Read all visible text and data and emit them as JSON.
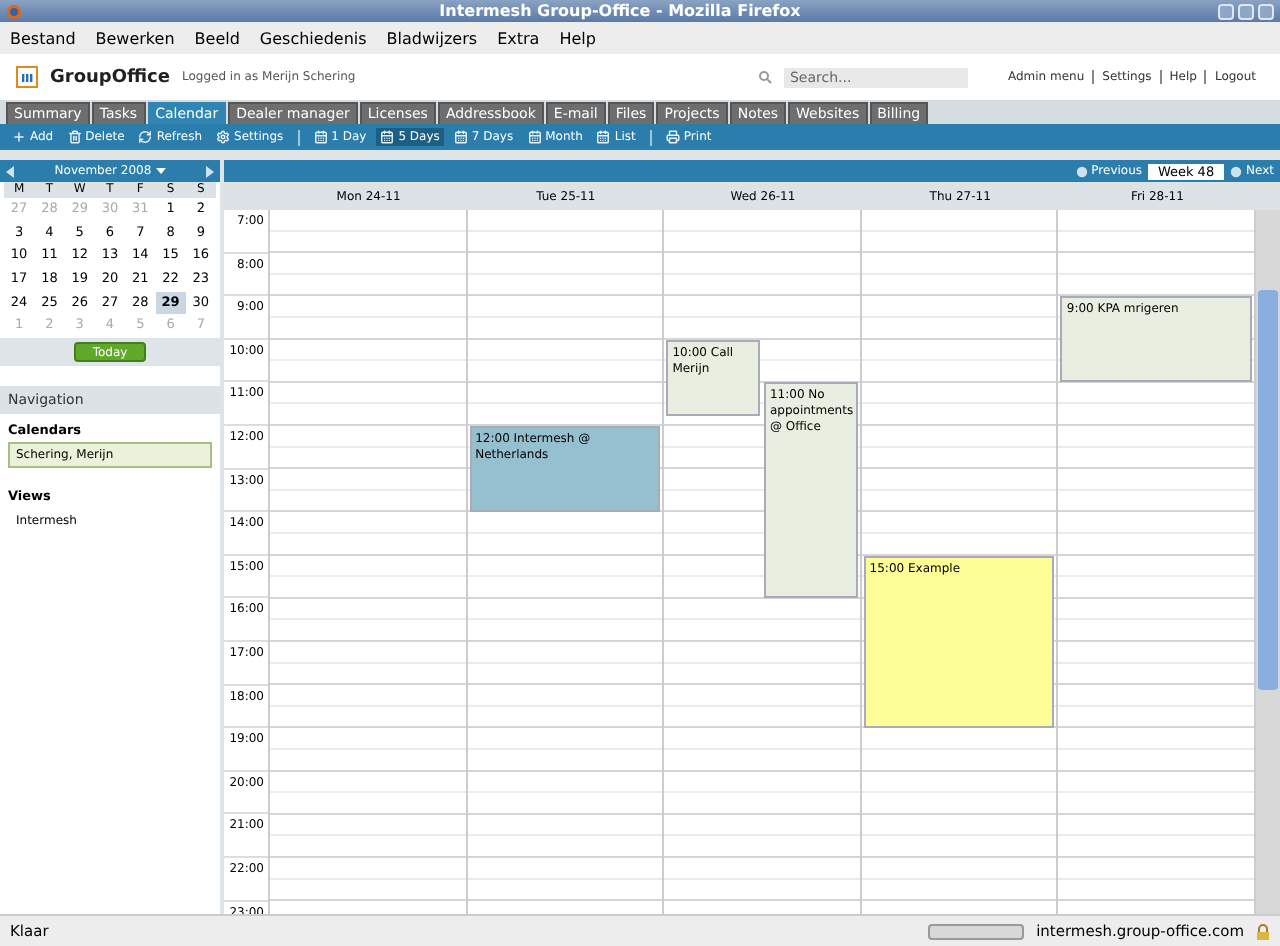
{
  "window": {
    "title": "Intermesh Group-Office - Mozilla Firefox"
  },
  "menu": [
    "Bestand",
    "Bewerken",
    "Beeld",
    "Geschiedenis",
    "Bladwijzers",
    "Extra",
    "Help"
  ],
  "header": {
    "app_name": "GroupOffice",
    "logged_in": "Logged in as Merijn Schering",
    "search": {
      "placeholder": "Search..."
    },
    "links": [
      "Admin menu",
      "Settings",
      "Help",
      "Logout"
    ]
  },
  "tabs": [
    {
      "label": "Summary",
      "selected": false
    },
    {
      "label": "Tasks",
      "selected": false
    },
    {
      "label": "Calendar",
      "selected": true
    },
    {
      "label": "Dealer manager",
      "selected": false
    },
    {
      "label": "Licenses",
      "selected": false
    },
    {
      "label": "Addressbook",
      "selected": false
    },
    {
      "label": "E-mail",
      "selected": false
    },
    {
      "label": "Files",
      "selected": false
    },
    {
      "label": "Projects",
      "selected": false
    },
    {
      "label": "Notes",
      "selected": false
    },
    {
      "label": "Websites",
      "selected": false
    },
    {
      "label": "Billing",
      "selected": false
    }
  ],
  "toolbar": [
    [
      {
        "kind": "add",
        "label": "Add",
        "selected": false
      },
      {
        "kind": "delete",
        "label": "Delete",
        "selected": false
      },
      {
        "kind": "refresh",
        "label": "Refresh",
        "selected": false
      },
      {
        "kind": "settings",
        "label": "Settings",
        "selected": false
      }
    ],
    [
      {
        "kind": "view",
        "label": "1 Day",
        "selected": false
      },
      {
        "kind": "view",
        "label": "5 Days",
        "selected": true
      },
      {
        "kind": "view",
        "label": "7 Days",
        "selected": false
      },
      {
        "kind": "view",
        "label": "Month",
        "selected": false
      },
      {
        "kind": "view",
        "label": "List",
        "selected": false
      }
    ],
    [
      {
        "kind": "print",
        "label": "Print",
        "selected": false
      }
    ]
  ],
  "date_picker": {
    "month": "November 2008",
    "weekdays": [
      "M",
      "T",
      "W",
      "T",
      "F",
      "S",
      "S"
    ],
    "weeks": [
      [
        {
          "day": "27",
          "other_month": true,
          "selected": false
        },
        {
          "day": "28",
          "other_month": true,
          "selected": false
        },
        {
          "day": "29",
          "other_month": true,
          "selected": false
        },
        {
          "day": "30",
          "other_month": true,
          "selected": false
        },
        {
          "day": "31",
          "other_month": true,
          "selected": false
        },
        {
          "day": "1",
          "other_month": false,
          "selected": false
        },
        {
          "day": "2",
          "other_month": false,
          "selected": false
        }
      ],
      [
        {
          "day": "3",
          "other_month": false,
          "selected": false
        },
        {
          "day": "4",
          "other_month": false,
          "selected": false
        },
        {
          "day": "5",
          "other_month": false,
          "selected": false
        },
        {
          "day": "6",
          "other_month": false,
          "selected": false
        },
        {
          "day": "7",
          "other_month": false,
          "selected": false
        },
        {
          "day": "8",
          "other_month": false,
          "selected": false
        },
        {
          "day": "9",
          "other_month": false,
          "selected": false
        }
      ],
      [
        {
          "day": "10",
          "other_month": false,
          "selected": false
        },
        {
          "day": "11",
          "other_month": false,
          "selected": false
        },
        {
          "day": "12",
          "other_month": false,
          "selected": false
        },
        {
          "day": "13",
          "other_month": false,
          "selected": false
        },
        {
          "day": "14",
          "other_month": false,
          "selected": false
        },
        {
          "day": "15",
          "other_month": false,
          "selected": false
        },
        {
          "day": "16",
          "other_month": false,
          "selected": false
        }
      ],
      [
        {
          "day": "17",
          "other_month": false,
          "selected": false
        },
        {
          "day": "18",
          "other_month": false,
          "selected": false
        },
        {
          "day": "19",
          "other_month": false,
          "selected": false
        },
        {
          "day": "20",
          "other_month": false,
          "selected": false
        },
        {
          "day": "21",
          "other_month": false,
          "selected": false
        },
        {
          "day": "22",
          "other_month": false,
          "selected": false
        },
        {
          "day": "23",
          "other_month": false,
          "selected": false
        }
      ],
      [
        {
          "day": "24",
          "other_month": false,
          "selected": false
        },
        {
          "day": "25",
          "other_month": false,
          "selected": false
        },
        {
          "day": "26",
          "other_month": false,
          "selected": false
        },
        {
          "day": "27",
          "other_month": false,
          "selected": false
        },
        {
          "day": "28",
          "other_month": false,
          "selected": false
        },
        {
          "day": "29",
          "other_month": false,
          "selected": true
        },
        {
          "day": "30",
          "other_month": false,
          "selected": false
        }
      ],
      [
        {
          "day": "1",
          "other_month": true,
          "selected": false
        },
        {
          "day": "2",
          "other_month": true,
          "selected": false
        },
        {
          "day": "3",
          "other_month": true,
          "selected": false
        },
        {
          "day": "4",
          "other_month": true,
          "selected": false
        },
        {
          "day": "5",
          "other_month": true,
          "selected": false
        },
        {
          "day": "6",
          "other_month": true,
          "selected": false
        },
        {
          "day": "7",
          "other_month": true,
          "selected": false
        }
      ]
    ],
    "today_button": "Today"
  },
  "navigation": {
    "title": "Navigation",
    "calendars_heading": "Calendars",
    "calendars": [
      {
        "label": "Schering, Merijn",
        "selected": true
      }
    ],
    "views_heading": "Views",
    "views": [
      {
        "label": "Intermesh",
        "selected": false
      }
    ]
  },
  "calendar": {
    "previous": "Previous",
    "week": "Week 48",
    "next": "Next",
    "days": [
      "Mon 24-11",
      "Tue 25-11",
      "Wed 26-11",
      "Thu 27-11",
      "Fri 28-11"
    ],
    "hours": [
      "7:00",
      "8:00",
      "9:00",
      "10:00",
      "11:00",
      "12:00",
      "13:00",
      "14:00",
      "15:00",
      "16:00",
      "17:00",
      "18:00",
      "19:00",
      "20:00",
      "21:00",
      "22:00",
      "23:00"
    ],
    "events": [
      {
        "text": "12:00 Intermesh @ Netherlands",
        "color": "#94c0d0"
      },
      {
        "text": "10:00 Call Merijn",
        "color": "#e8eee0"
      },
      {
        "text": "11:00 No appointments @ Office",
        "color": "#e8eee0"
      },
      {
        "text": "15:00 Example",
        "color": "#fefe98"
      },
      {
        "text": "9:00 KPA mrigeren",
        "color": "#e8eee0"
      }
    ]
  },
  "status_bar": {
    "text": "Klaar",
    "progress": {
      "level": 0
    },
    "host": "intermesh.group-office.com"
  }
}
